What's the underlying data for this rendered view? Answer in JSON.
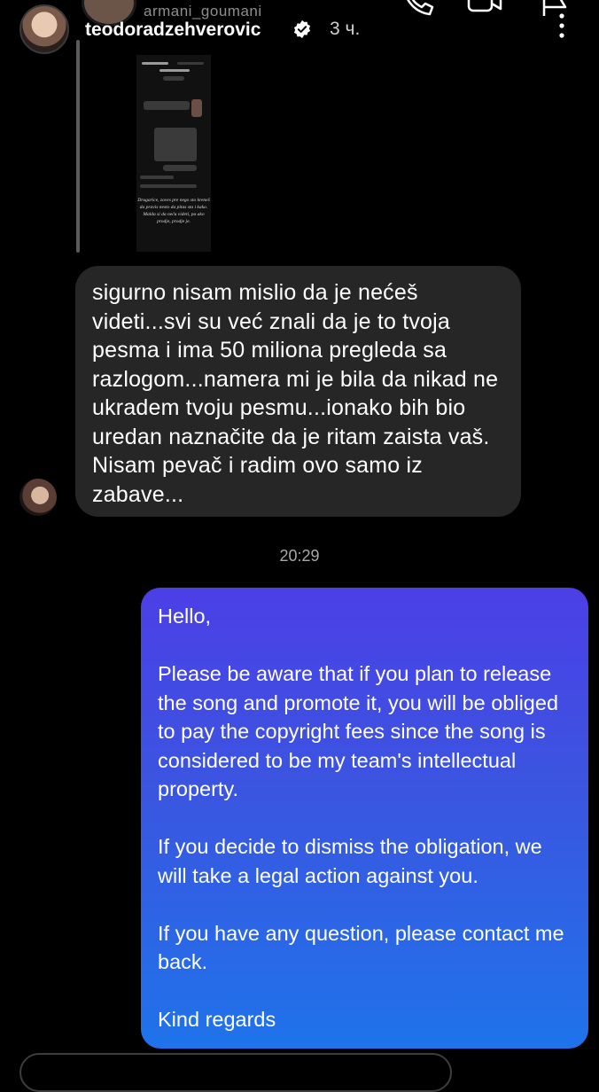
{
  "header": {
    "other_username": "armani_goumani",
    "username": "teodoradzehverovic",
    "time_ago": "3 ч."
  },
  "shared_post": {
    "caption": "Drugarice, zoves pre nego sto kreneš da pravis nesto da pitas sta i kako. Malda si da neću videti, pa ako prodje, prodje je."
  },
  "incoming_message": {
    "text": "sigurno nisam mislio da je nećeš videti...svi su već znali da je to tvoja pesma i ima 50 miliona pregleda sa razlogom...namera mi je bila da nikad ne ukradem tvoju pesmu...ionako bih bio uredan naznačite da je ritam zaista vaš. Nisam pevač i radim ovo samo iz zabave..."
  },
  "timestamp": "20:29",
  "outgoing_message": {
    "greeting": "Hello,",
    "p1": "Please be aware that if you plan to release the song and promote it, you will be obliged to pay the copyright fees since the song is considered to be my team's intellectual property.",
    "p2": "If you decide to dismiss the obligation, we will take a legal action against you.",
    "p3": "If you have any question, please contact me back.",
    "closing": "Kind regards"
  },
  "icons": {
    "call": "phone-icon",
    "video": "video-camera-icon",
    "flag": "flag-icon",
    "more": "more-vertical-icon",
    "verified": "verified-badge-icon"
  }
}
